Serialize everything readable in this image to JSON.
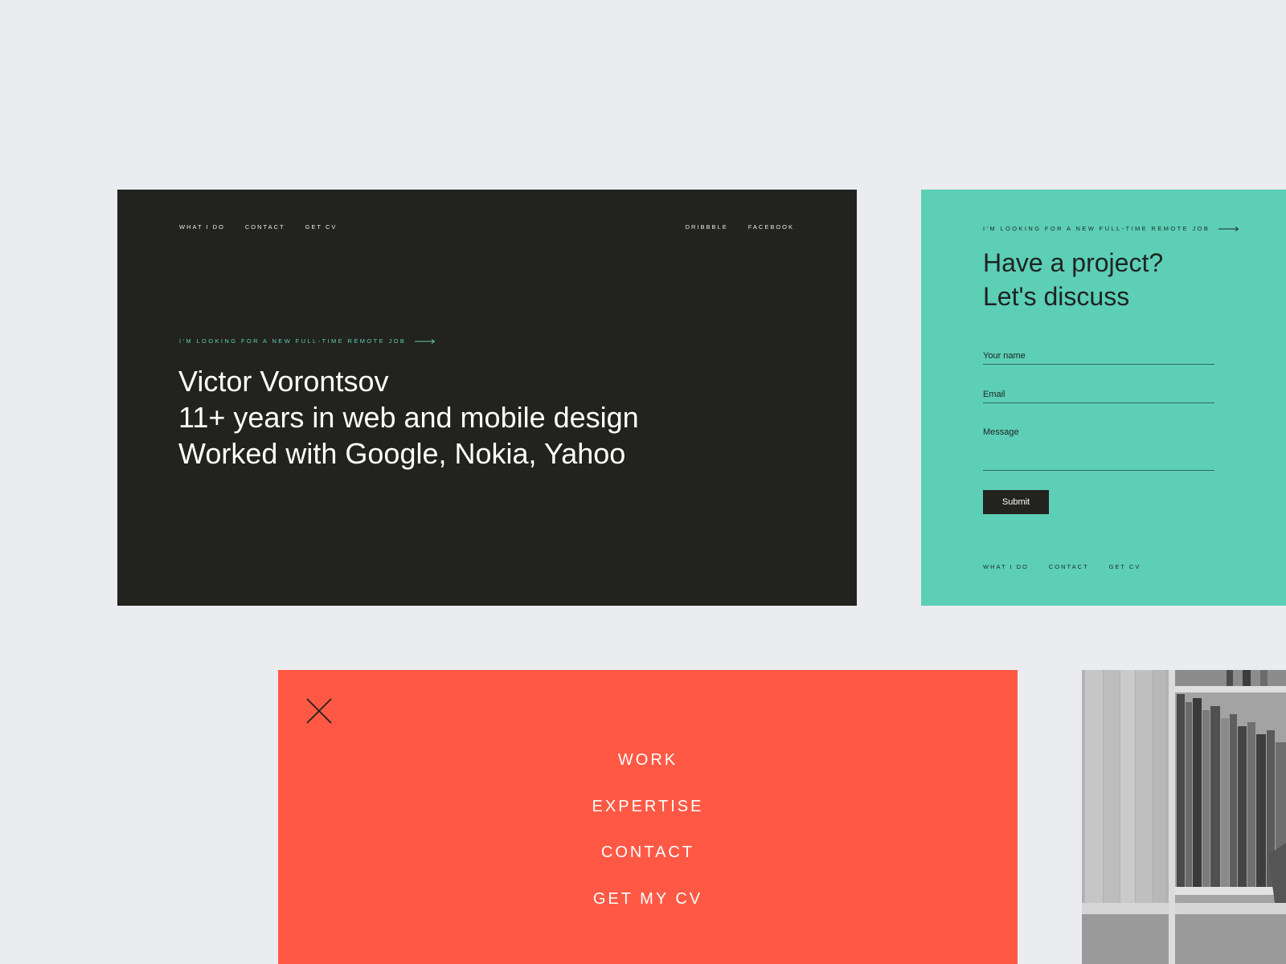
{
  "hero": {
    "nav_left": [
      "WHAT I DO",
      "CONTACT",
      "GET CV"
    ],
    "nav_right": [
      "DRIBBBLE",
      "FACEBOOK"
    ],
    "eyebrow": "I'M LOOKING FOR A NEW FULL-TIME REMOTE JOB",
    "headline": [
      "Victor Vorontsov",
      "11+ years in web and mobile design",
      "Worked with Google, Nokia, Yahoo"
    ]
  },
  "contact": {
    "eyebrow": "I'M LOOKING FOR A NEW FULL-TIME REMOTE JOB",
    "title_line1": "Have a project?",
    "title_line2": "Let's discuss",
    "name_placeholder": "Your name",
    "email_placeholder": "Email",
    "message_placeholder": "Message",
    "submit_label": "Submit",
    "footer_nav": [
      "WHAT I DO",
      "CONTACT",
      "GET CV"
    ]
  },
  "menu": {
    "items": [
      "WORK",
      "EXPERTISE",
      "CONTACT",
      "GET MY CV"
    ]
  },
  "icons": {
    "eyebrow_arrow": "arrow-right-icon",
    "close": "close-icon"
  },
  "colors": {
    "background": "#ebecef",
    "dark": "#22221e",
    "teal": "#5ccfb6",
    "coral": "#ff5945",
    "white": "#ffffff"
  }
}
